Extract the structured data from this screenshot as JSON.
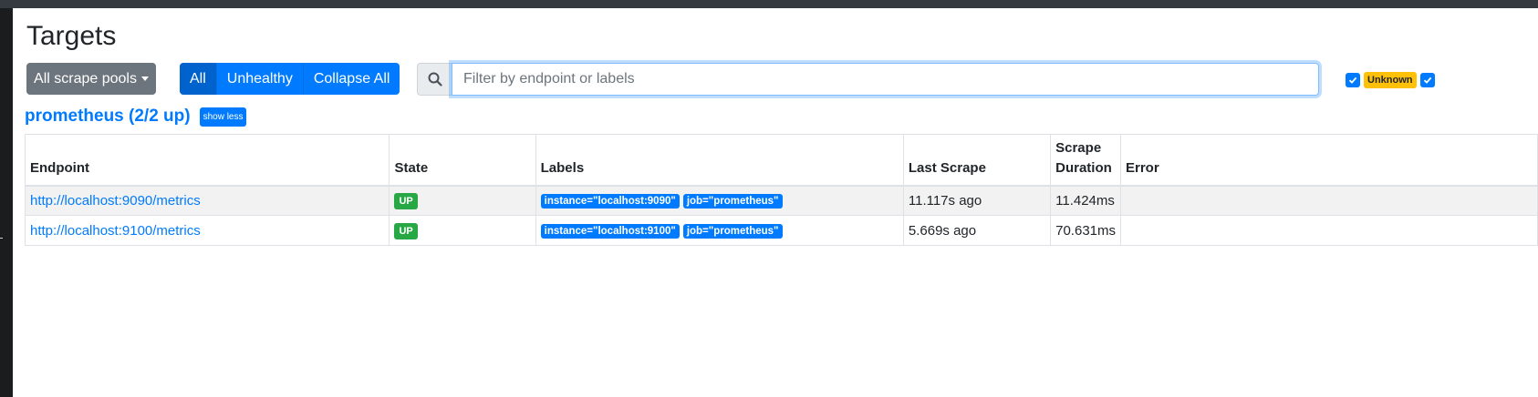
{
  "page": {
    "title": "Targets"
  },
  "toolbar": {
    "pools_label": "All scrape pools",
    "filter_all": "All",
    "filter_unhealthy": "Unhealthy",
    "collapse_all": "Collapse All",
    "search_placeholder": "Filter by endpoint or labels",
    "health_filter_unknown": "Unknown"
  },
  "pool": {
    "title": "prometheus (2/2 up)",
    "toggle_label": "show less"
  },
  "table": {
    "headers": [
      "Endpoint",
      "State",
      "Labels",
      "Last Scrape",
      "Scrape Duration",
      "Error"
    ],
    "rows": [
      {
        "endpoint": "http://localhost:9090/metrics",
        "state": "UP",
        "labels": [
          "instance=\"localhost:9090\"",
          "job=\"prometheus\""
        ],
        "last_scrape": "11.117s ago",
        "duration": "11.424ms",
        "error": ""
      },
      {
        "endpoint": "http://localhost:9100/metrics",
        "state": "UP",
        "labels": [
          "instance=\"localhost:9100\"",
          "job=\"prometheus\""
        ],
        "last_scrape": "5.669s ago",
        "duration": "70.631ms",
        "error": ""
      }
    ]
  },
  "colors": {
    "primary": "#007bff",
    "success": "#28a745",
    "warning": "#ffc107",
    "secondary": "#6c757d"
  },
  "icons": {
    "search": "search-icon",
    "check": "check-icon"
  }
}
